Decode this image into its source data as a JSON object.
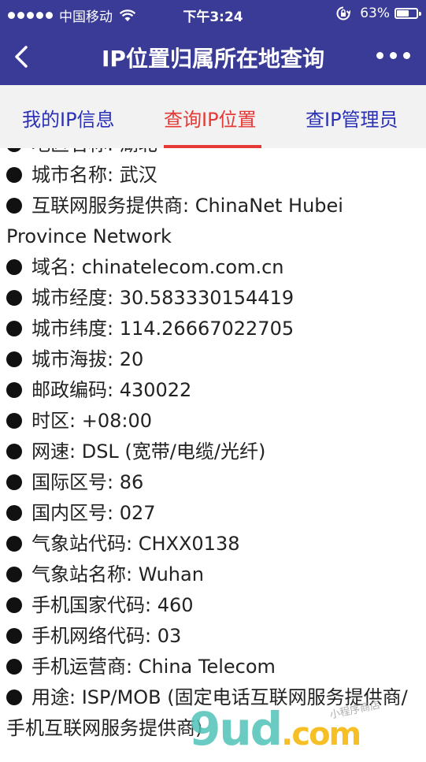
{
  "status_bar": {
    "carrier": "中国移动",
    "time": "下午3:24",
    "battery_percent": "63%",
    "battery_level": 0.63
  },
  "nav": {
    "title": "IP位置归属所在地查询"
  },
  "tabs": [
    {
      "label": "我的IP信息",
      "active": false
    },
    {
      "label": "查询IP位置",
      "active": true
    },
    {
      "label": "查IP管理员",
      "active": false
    }
  ],
  "info_items": [
    "地区名称: 湖北",
    "城市名称: 武汉",
    "互联网服务提供商: ChinaNet Hubei Province Network",
    "域名: chinatelecom.com.cn",
    "城市经度: 30.583330154419",
    "城市纬度: 114.26667022705",
    "城市海拔: 20",
    "邮政编码: 430022",
    "时区: +08:00",
    "网速: DSL (宽带/电缆/光纤)",
    "国际区号: 86",
    "国内区号: 027",
    "气象站代码: CHXX0138",
    "气象站名称: Wuhan",
    "手机国家代码: 460",
    "手机网络代码: 03",
    "手机运营商: China Telecom",
    "用途: ISP/MOB (固定电话互联网服务提供商/手机互联网服务提供商)"
  ],
  "watermark": {
    "logo_main": "9ud",
    "logo_suffix": ".com",
    "sub": "小程序商店"
  },
  "colors": {
    "header_bg": "#3a3b96",
    "tab_bg": "#f2f2f2",
    "tab_text": "#2a30b7",
    "tab_active": "#e53935"
  }
}
